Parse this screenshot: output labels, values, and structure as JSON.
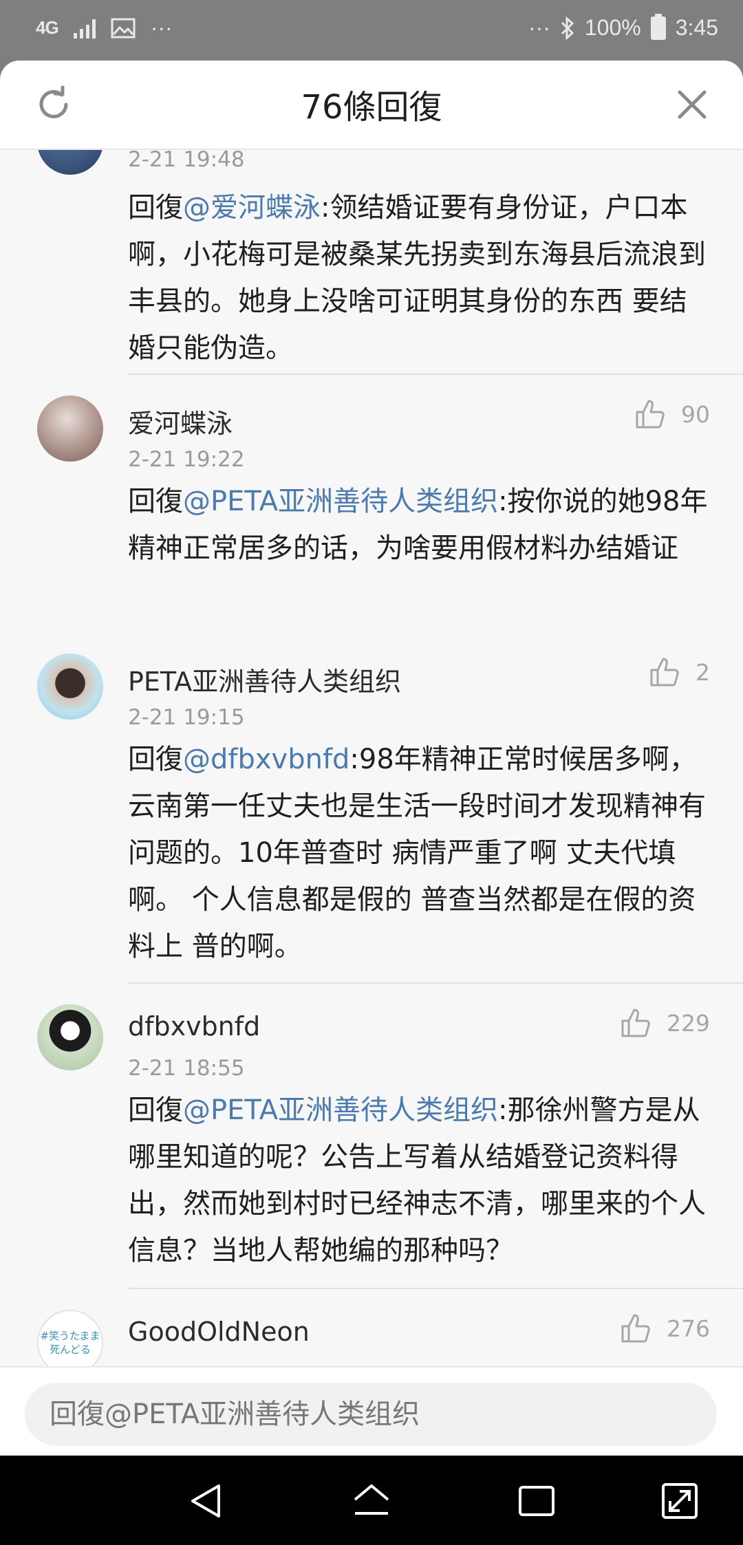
{
  "status_bar": {
    "network": "4G",
    "more_left": "···",
    "more_right": "···",
    "battery": "100%",
    "time": "3:45"
  },
  "header": {
    "title": "76條回復"
  },
  "comments": [
    {
      "time": "2-21 19:48",
      "prefix": "回復",
      "mention": "@爱河蝶泳",
      "text": ":领结婚证要有身份证，户口本啊，小花梅可是被桑某先拐卖到东海县后流浪到丰县的。她身上没啥可证明其身份的东西  要结婚只能伪造。"
    },
    {
      "name": "爱河蝶泳",
      "time": "2-21 19:22",
      "likes": "90",
      "prefix": "回復",
      "mention": "@PETA亚洲善待人类组织",
      "text": ":按你说的她98年精神正常居多的话，为啥要用假材料办结婚证"
    },
    {
      "name": "PETA亚洲善待人类组织",
      "time": "2-21 19:15",
      "likes": "2",
      "prefix": "回復",
      "mention": "@dfbxvbnfd",
      "text": ":98年精神正常时候居多啊，云南第一任丈夫也是生活一段时间才发现精神有问题的。10年普查时 病情严重了啊 丈夫代填啊。  个人信息都是假的 普查当然都是在假的资料上 普的啊。"
    },
    {
      "name": "dfbxvbnfd",
      "time": "2-21 18:55",
      "likes": "229",
      "prefix": "回復",
      "mention": "@PETA亚洲善待人类组织",
      "text": ":那徐州警方是从哪里知道的呢？公告上写着从结婚登记资料得出，然而她到村时已经神志不清，哪里来的个人信息？当地人帮她编的那种吗？"
    },
    {
      "name": "GoodOldNeon",
      "likes": "276",
      "avatar_text_1": "#笑うたまま",
      "avatar_text_2": "死んどる"
    }
  ],
  "reply_bar": {
    "placeholder": "回復@PETA亚洲善待人类组织"
  },
  "colors": {
    "mention": "#4c7aae",
    "background": "#f7f7f7",
    "status_bar": "#7f7f7f"
  }
}
